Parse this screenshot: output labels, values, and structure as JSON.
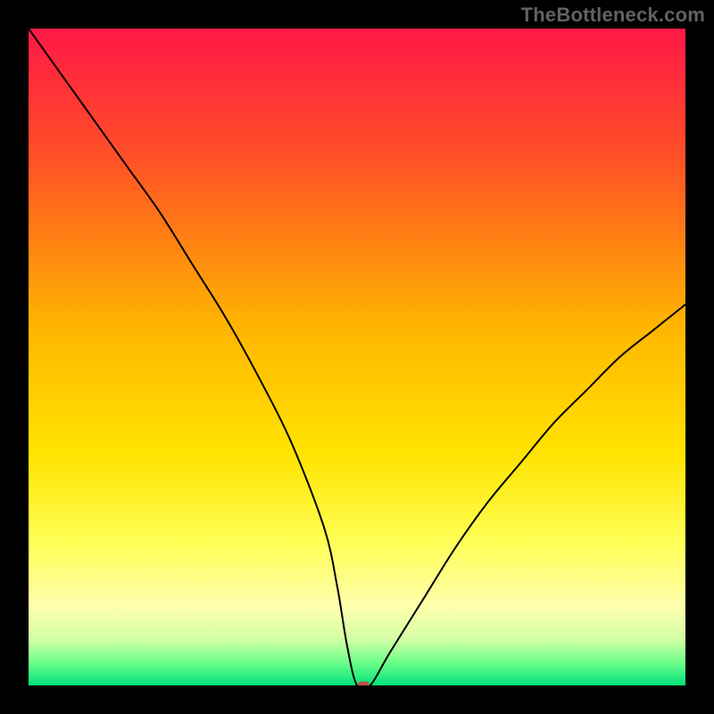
{
  "watermark": "TheBottleneck.com",
  "chart_data": {
    "type": "line",
    "title": "",
    "xlabel": "",
    "ylabel": "",
    "xlim": [
      0,
      100
    ],
    "ylim": [
      0,
      100
    ],
    "background": {
      "type": "vertical_gradient",
      "stops": [
        {
          "offset": 0.0,
          "color": "#ff1846"
        },
        {
          "offset": 0.2,
          "color": "#ff5126"
        },
        {
          "offset": 0.45,
          "color": "#ffb400"
        },
        {
          "offset": 0.65,
          "color": "#ffe400"
        },
        {
          "offset": 0.78,
          "color": "#ffff55"
        },
        {
          "offset": 0.88,
          "color": "#ffffad"
        },
        {
          "offset": 0.93,
          "color": "#d2ffa6"
        },
        {
          "offset": 0.965,
          "color": "#6eff8a"
        },
        {
          "offset": 1.0,
          "color": "#00e27a"
        }
      ]
    },
    "series": [
      {
        "name": "bottleneck-curve",
        "color": "#000000",
        "stroke_width": 2,
        "x": [
          0,
          5,
          10,
          15,
          20,
          25,
          30,
          35,
          40,
          45,
          47,
          48.5,
          50,
          52,
          55,
          60,
          65,
          70,
          75,
          80,
          85,
          90,
          95,
          100
        ],
        "y": [
          100,
          93,
          86,
          79,
          72,
          64,
          56,
          47,
          37,
          24,
          15,
          6,
          0,
          0,
          5,
          13,
          21,
          28,
          34,
          40,
          45,
          50,
          54,
          58
        ]
      }
    ],
    "markers": [
      {
        "name": "notch-marker",
        "shape": "rounded-rect",
        "x": 51,
        "y": 0,
        "width_frac": 0.018,
        "height_frac": 0.012,
        "color": "#c05048"
      }
    ]
  }
}
